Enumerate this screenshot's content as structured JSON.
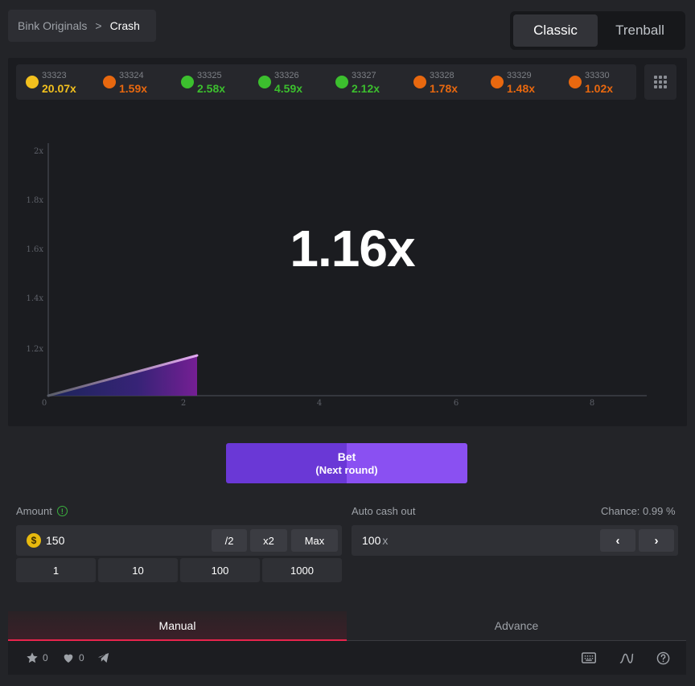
{
  "breadcrumb": {
    "parent": "Bink Originals",
    "separator": ">",
    "current": "Crash"
  },
  "mode_tabs": [
    {
      "label": "Classic",
      "active": true
    },
    {
      "label": "Trenball",
      "active": false
    }
  ],
  "history": [
    {
      "id": "33323",
      "value": "20.07x",
      "color": "#f2c01e"
    },
    {
      "id": "33324",
      "value": "1.59x",
      "color": "#e8680f"
    },
    {
      "id": "33325",
      "value": "2.58x",
      "color": "#3cbf2e"
    },
    {
      "id": "33326",
      "value": "4.59x",
      "color": "#3cbf2e"
    },
    {
      "id": "33327",
      "value": "2.12x",
      "color": "#3cbf2e"
    },
    {
      "id": "33328",
      "value": "1.78x",
      "color": "#e8680f"
    },
    {
      "id": "33329",
      "value": "1.48x",
      "color": "#e8680f"
    },
    {
      "id": "33330",
      "value": "1.02x",
      "color": "#e8680f"
    }
  ],
  "graph": {
    "y_ticks": [
      "2x",
      "1.8x",
      "1.6x",
      "1.4x",
      "1.2x"
    ],
    "x_ticks": [
      "0",
      "2",
      "4",
      "6",
      "8"
    ],
    "current_multiplier": "1.16x"
  },
  "bet_button": {
    "title": "Bet",
    "subtitle": "(Next round)"
  },
  "amount": {
    "label": "Amount",
    "info_icon": "!",
    "currency_icon": "$",
    "value": "150",
    "half": "/2",
    "double": "x2",
    "max": "Max",
    "quick": [
      "1",
      "10",
      "100",
      "1000"
    ]
  },
  "auto_cashout": {
    "label": "Auto cash out",
    "value": "100",
    "unit": "x",
    "chance": "Chance: 0.99 %",
    "prev": "‹",
    "next": "›"
  },
  "tabs": {
    "manual": "Manual",
    "advance": "Advance"
  },
  "footer": {
    "stars": "0",
    "likes": "0"
  },
  "colors": {
    "accent_red": "#e8244d",
    "bet_purple": "#7c46ea",
    "win_green": "#3cbf2e",
    "loss_orange": "#e8680f"
  }
}
